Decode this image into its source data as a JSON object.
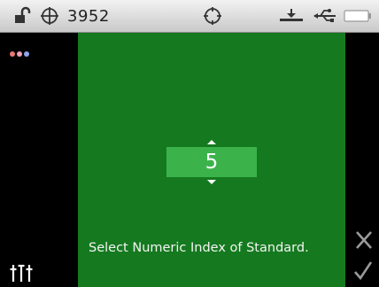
{
  "status_bar": {
    "measurement_count": "3952",
    "icons": [
      "lock-open-icon",
      "crosshair-icon",
      "target-icon",
      "dock-icon",
      "usb-icon",
      "battery-icon"
    ]
  },
  "sidebar": {
    "menu_icon": "three-dots-icon",
    "settings_icon": "sliders-icon"
  },
  "main": {
    "numeric_index": "5",
    "instruction": "Select Numeric Index of Standard."
  },
  "right_panel": {
    "cancel_icon": "x-icon",
    "confirm_icon": "check-icon"
  },
  "colors": {
    "panel_background": "#157a1f",
    "field_background": "#3bb34a",
    "dot_1": "#e8796f",
    "dot_2": "#f0a0b8",
    "dot_3": "#8fa7e8"
  }
}
